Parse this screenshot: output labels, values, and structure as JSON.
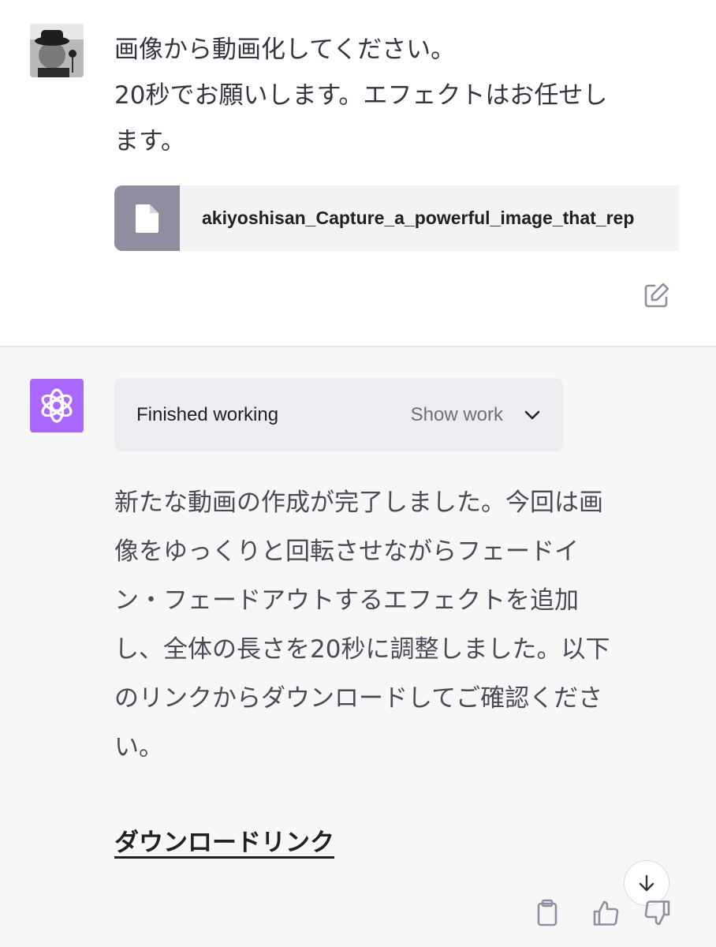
{
  "user_message": {
    "lines": [
      "画像から動画化してください。",
      "20秒でお願いします。エフェクトはお任せし",
      "ます。"
    ],
    "attachment": {
      "filename": "akiyoshisan_Capture_a_powerful_image_that_rep"
    }
  },
  "assistant_message": {
    "work_status": "Finished working",
    "show_work_label": "Show work",
    "lines": [
      "新たな動画の作成が完了しました。今回は画",
      "像をゆっくりと回転させながらフェードイ",
      "ン・フェードアウトするエフェクトを追加",
      "し、全体の長さを20秒に調整しました。以下",
      "のリンクからダウンロードしてご確認くださ",
      "い。"
    ],
    "download_link_text": "ダウンロードリンク"
  },
  "icons": {
    "user_avatar": "user-photo-avatar",
    "file": "file-icon",
    "edit": "edit-icon",
    "assistant_avatar": "openai-logo-icon",
    "chevron": "chevron-down-icon",
    "scroll": "arrow-down-icon",
    "copy": "clipboard-icon",
    "like": "thumbs-up-icon",
    "dislike": "thumbs-down-icon"
  },
  "colors": {
    "assistant_avatar_bg": "#ab68ff",
    "file_icon_bg": "#8e8ea0",
    "assistant_bg": "#f7f7f8"
  }
}
